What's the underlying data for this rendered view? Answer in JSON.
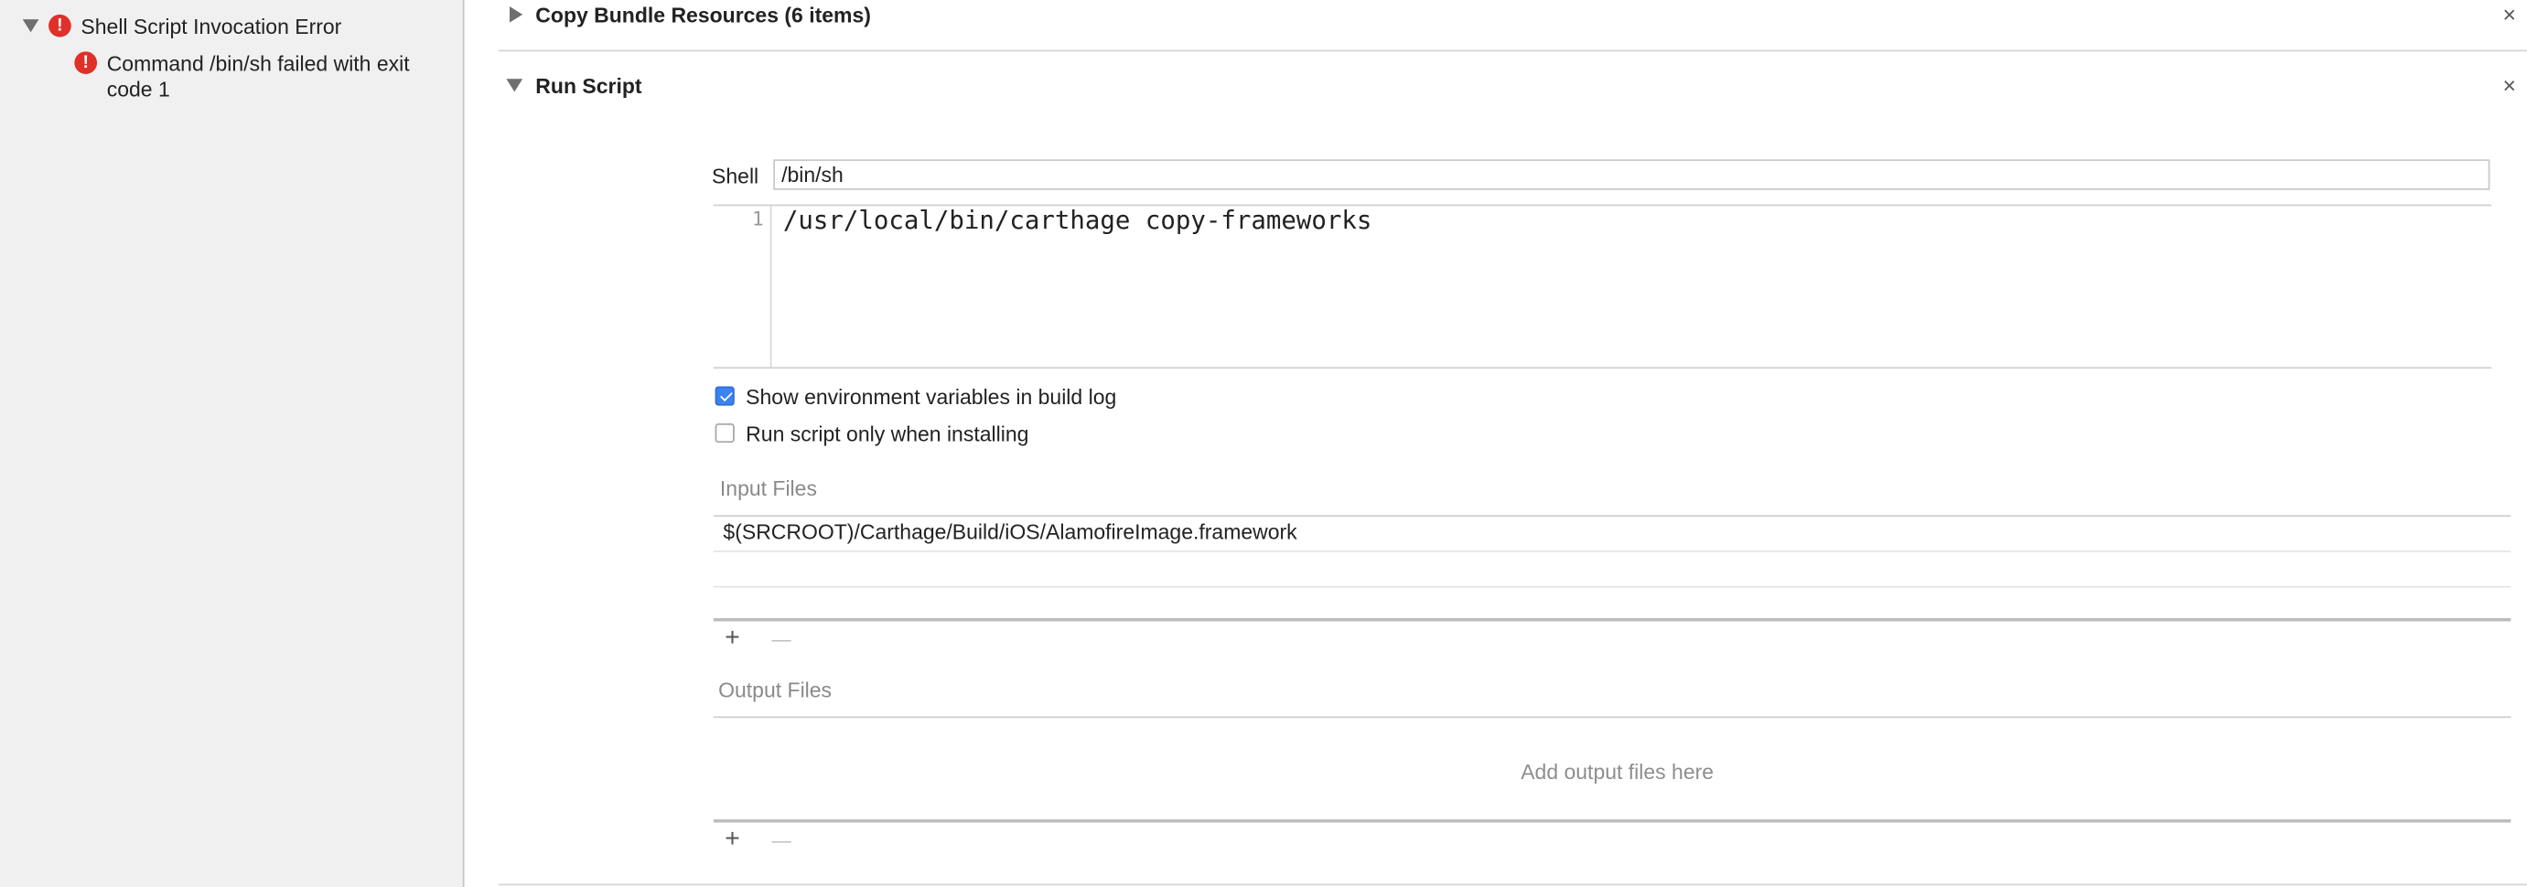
{
  "sidebar": {
    "error_title": "Shell Script Invocation Error",
    "error_detail_line1": "Command /bin/sh failed with exit",
    "error_detail_line2": "code 1",
    "error_glyph": "!"
  },
  "phases": {
    "copy_bundle": {
      "title": "Copy Bundle Resources (6 items)"
    },
    "run_script": {
      "title": "Run Script",
      "shell_label": "Shell",
      "shell_value": "/bin/sh",
      "script_line_number": "1",
      "script_text": "/usr/local/bin/carthage copy-frameworks",
      "show_env_label": "Show environment variables in build log",
      "show_env_checked": true,
      "run_only_install_label": "Run script only when installing",
      "run_only_install_checked": false,
      "input_files_label": "Input Files",
      "input_files": [
        "$(SRCROOT)/Carthage/Build/iOS/AlamofireImage.framework"
      ],
      "output_files_label": "Output Files",
      "output_placeholder": "Add output files here"
    }
  },
  "icons": {
    "close": "×",
    "plus": "+",
    "minus": "—"
  },
  "colors": {
    "error_red": "#e0302a",
    "checkbox_blue": "#3b82f0"
  }
}
